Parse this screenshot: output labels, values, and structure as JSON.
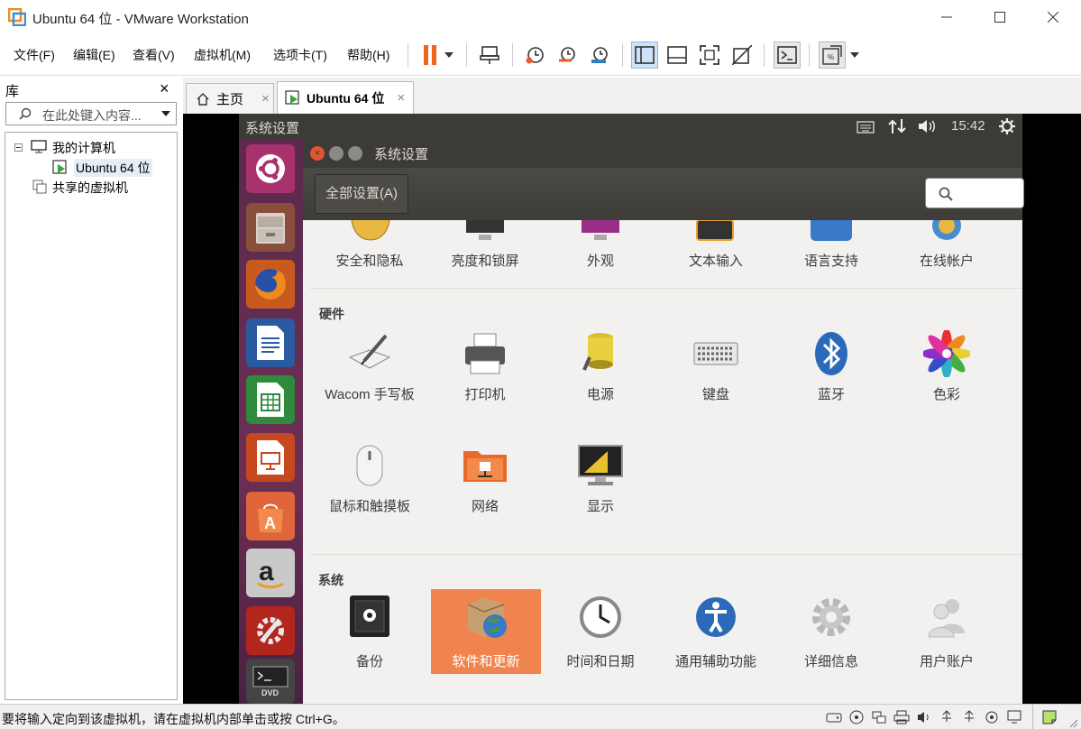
{
  "window": {
    "title": "Ubuntu 64 位 - VMware Workstation"
  },
  "menus": [
    "文件(F)",
    "编辑(E)",
    "查看(V)",
    "虚拟机(M)",
    "选项卡(T)",
    "帮助(H)"
  ],
  "library": {
    "title": "库",
    "search_placeholder": "在此处键入内容...",
    "tree": {
      "root": "我的计算机",
      "vm": "Ubuntu 64 位",
      "shared": "共享的虚拟机"
    }
  },
  "tabs": [
    {
      "label": "主页"
    },
    {
      "label": "Ubuntu 64 位"
    }
  ],
  "guest": {
    "topbar": {
      "app_title": "系统设置",
      "time": "15:42"
    },
    "window_title": "系统设置",
    "all_settings_button": "全部设置(A)",
    "personal_row": [
      "安全和隐私",
      "亮度和锁屏",
      "外观",
      "文本输入",
      "语言支持",
      "在线帐户"
    ],
    "hardware": {
      "heading": "硬件",
      "items": [
        "Wacom 手写板",
        "打印机",
        "电源",
        "键盘",
        "蓝牙",
        "色彩",
        "鼠标和触摸板",
        "网络",
        "显示"
      ]
    },
    "system": {
      "heading": "系统",
      "items": [
        "备份",
        "软件和更新",
        "时间和日期",
        "通用辅助功能",
        "详细信息",
        "用户账户"
      ],
      "highlighted": "软件和更新"
    }
  },
  "statusbar": {
    "text": "要将输入定向到该虚拟机，请在虚拟机内部单击或按 Ctrl+G。"
  },
  "colors": {
    "accent_orange": "#f0844f",
    "ubuntu_topbar": "#3c3b37",
    "launcher_purple": "#5e2750"
  }
}
